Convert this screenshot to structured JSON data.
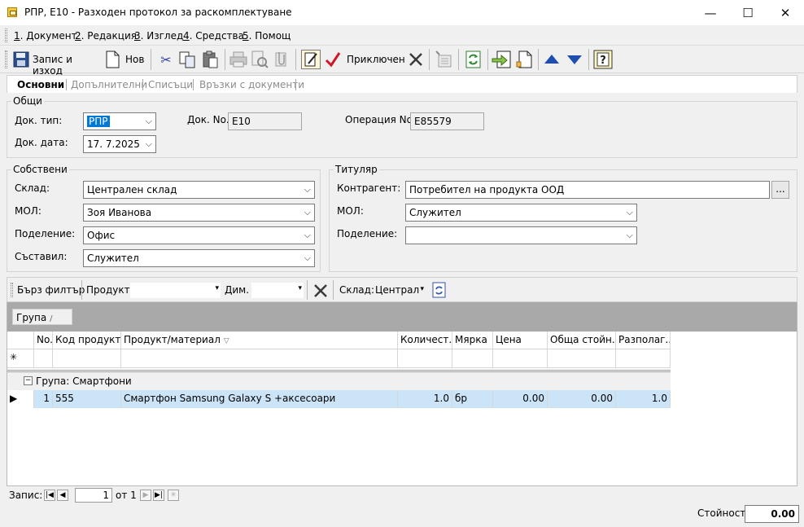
{
  "window": {
    "title": "РПР, E10 - Разходен протокол за раскомплектуване",
    "minimize": "—",
    "maximize": "☐",
    "close": "✕"
  },
  "menu": {
    "items": [
      {
        "key": "1",
        "label": ". Документ"
      },
      {
        "key": "2",
        "label": ". Редакция"
      },
      {
        "key": "3",
        "label": ". Изглед"
      },
      {
        "key": "4",
        "label": ". Средства"
      },
      {
        "key": "5",
        "label": ". Помощ"
      }
    ]
  },
  "toolbar": {
    "save_exit_label": "Запис и изход",
    "new_label": "Нов",
    "finished_label": "Приключен"
  },
  "tabs": [
    {
      "label": "Основни"
    },
    {
      "label": "Допълнителни"
    },
    {
      "label": "Списъци"
    },
    {
      "label": "Връзки с документи"
    }
  ],
  "general": {
    "title": "Общи",
    "doc_type_label": "Док. тип:",
    "doc_type_value": "РПР",
    "doc_no_label": "Док. No.",
    "doc_no_value": "E10",
    "op_no_label": "Операция No.",
    "op_no_value": "E85579",
    "doc_date_label": "Док. дата:",
    "doc_date_value": "17.  7.2025"
  },
  "own": {
    "title": "Собствени",
    "warehouse_label": "Склад:",
    "warehouse_value": "Централен склад",
    "mol_label": "МОЛ:",
    "mol_value": "Зоя Иванова",
    "division_label": "Поделение:",
    "division_value": "Офис",
    "composer_label": "Съставил:",
    "composer_value": "Служител"
  },
  "holder": {
    "title": "Титуляр",
    "partner_label": "Контрагент:",
    "partner_value": "Потребител на продукта ООД",
    "partner_button": "...",
    "mol_label": "МОЛ:",
    "mol_value": "Служител",
    "division_label": "Поделение:",
    "division_value": ""
  },
  "filter": {
    "quick_filter_label": "Бърз филтър",
    "product_label": "Продукт:",
    "dim_label": "Дим.",
    "warehouse_label": "Склад:",
    "warehouse_value": "Централ"
  },
  "grid": {
    "group_chip": "Група",
    "group_chip_sort": "/",
    "columns": [
      "No.",
      "Код продукт...",
      "Продукт/материал",
      "Количест...",
      "Мярка",
      "Цена",
      "Обща стойн...",
      "Разполаг..."
    ],
    "sort_marker": "▽",
    "new_row_marker": "✳",
    "group_expander": "−",
    "group_row_label": "Група: Смартфони",
    "current_row_marker": "▶",
    "rows": [
      {
        "no": "1",
        "code": "555",
        "name": "Смартфон Samsung Galaxy S +аксесоари",
        "qty": "1.0",
        "unit": "бр",
        "price": "0.00",
        "total": "0.00",
        "available": "1.0"
      }
    ]
  },
  "navigator": {
    "record_label": "Запис:",
    "current": "1",
    "of_label": "от 1"
  },
  "footer": {
    "value_label": "Стойност:",
    "value": "0.00"
  }
}
